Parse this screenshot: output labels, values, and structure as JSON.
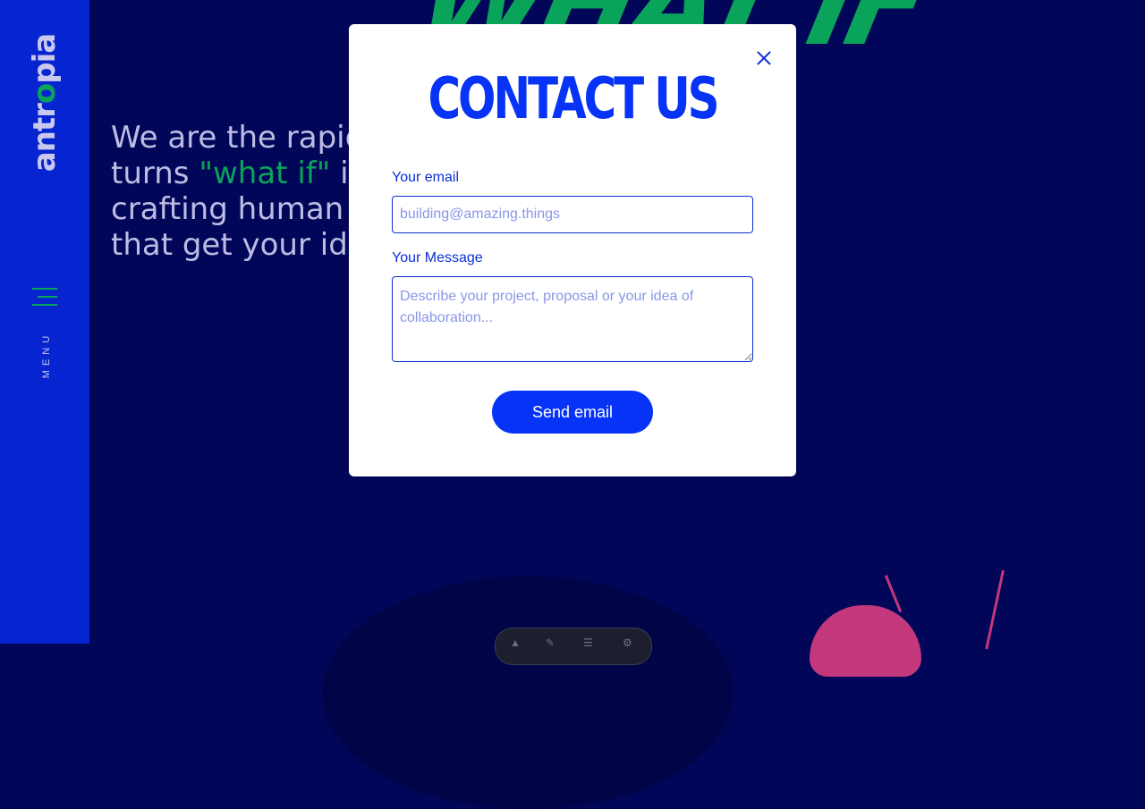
{
  "sidebar": {
    "logo_prefix": "antr",
    "logo_o": "o",
    "logo_suffix": "pia",
    "menu_label": "MENU"
  },
  "background": {
    "headline_fragment": "WHAT IF",
    "intro_line1": "We are the rapid",
    "intro_line2_prefix": "turns ",
    "intro_highlight": "\"what if\"",
    "intro_line2_suffix": " in",
    "intro_line3": "crafting human",
    "intro_line4": "that get your ide"
  },
  "modal": {
    "title": "CONTACT US",
    "email_label": "Your email",
    "email_value": "",
    "email_placeholder": "building@amazing.things",
    "message_label": "Your Message",
    "message_value": "",
    "message_placeholder": "Describe your project, proposal or your idea of collaboration...",
    "submit_label": "Send email"
  },
  "colors": {
    "page_background": "#020659",
    "sidebar": "#0624cf",
    "accent_green": "#0aa35a",
    "primary_blue": "#0633f5",
    "pink_decoration": "#c3387c"
  }
}
